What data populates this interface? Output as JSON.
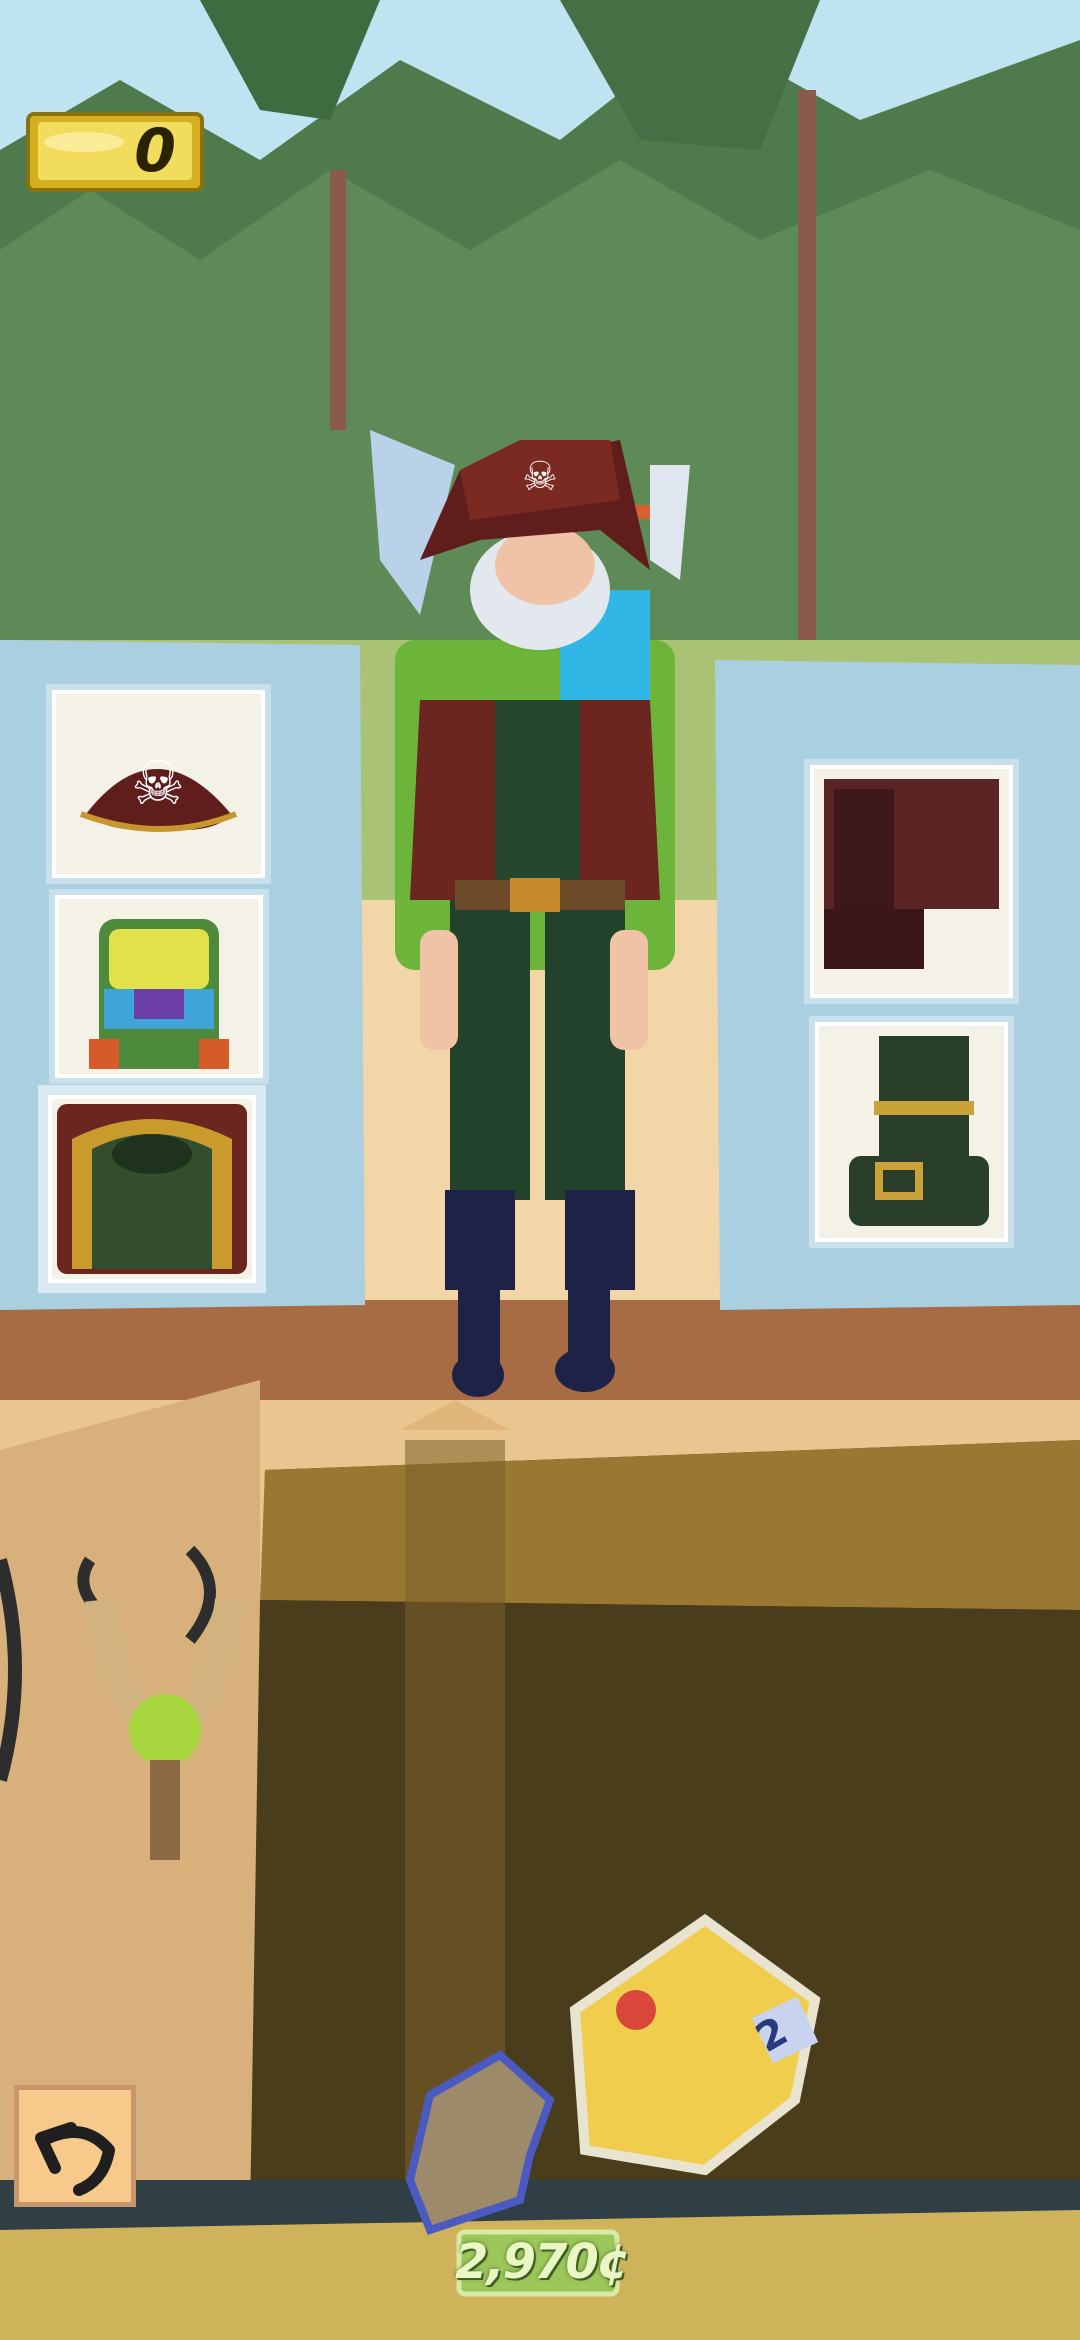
{
  "hud": {
    "score": "0",
    "money": "2,970¢"
  },
  "outfit": {
    "left_slots": [
      {
        "name": "pirate-hat",
        "selected": false
      },
      {
        "name": "hiking-backpack",
        "selected": false
      },
      {
        "name": "green-shirt",
        "selected": true
      }
    ],
    "right_slots": [
      {
        "name": "brown-pants",
        "selected": false
      },
      {
        "name": "green-boots",
        "selected": false
      }
    ]
  },
  "items": {
    "slingshot": "slingshot",
    "rock": "rock",
    "gold_nugget_count": "2"
  },
  "colors": {
    "sky": "#bfe3f0",
    "forest": "#4f7a4c",
    "panel": "#a9cfe0",
    "crate": "#7a5a1a",
    "money_tag": "#9cc75a"
  }
}
